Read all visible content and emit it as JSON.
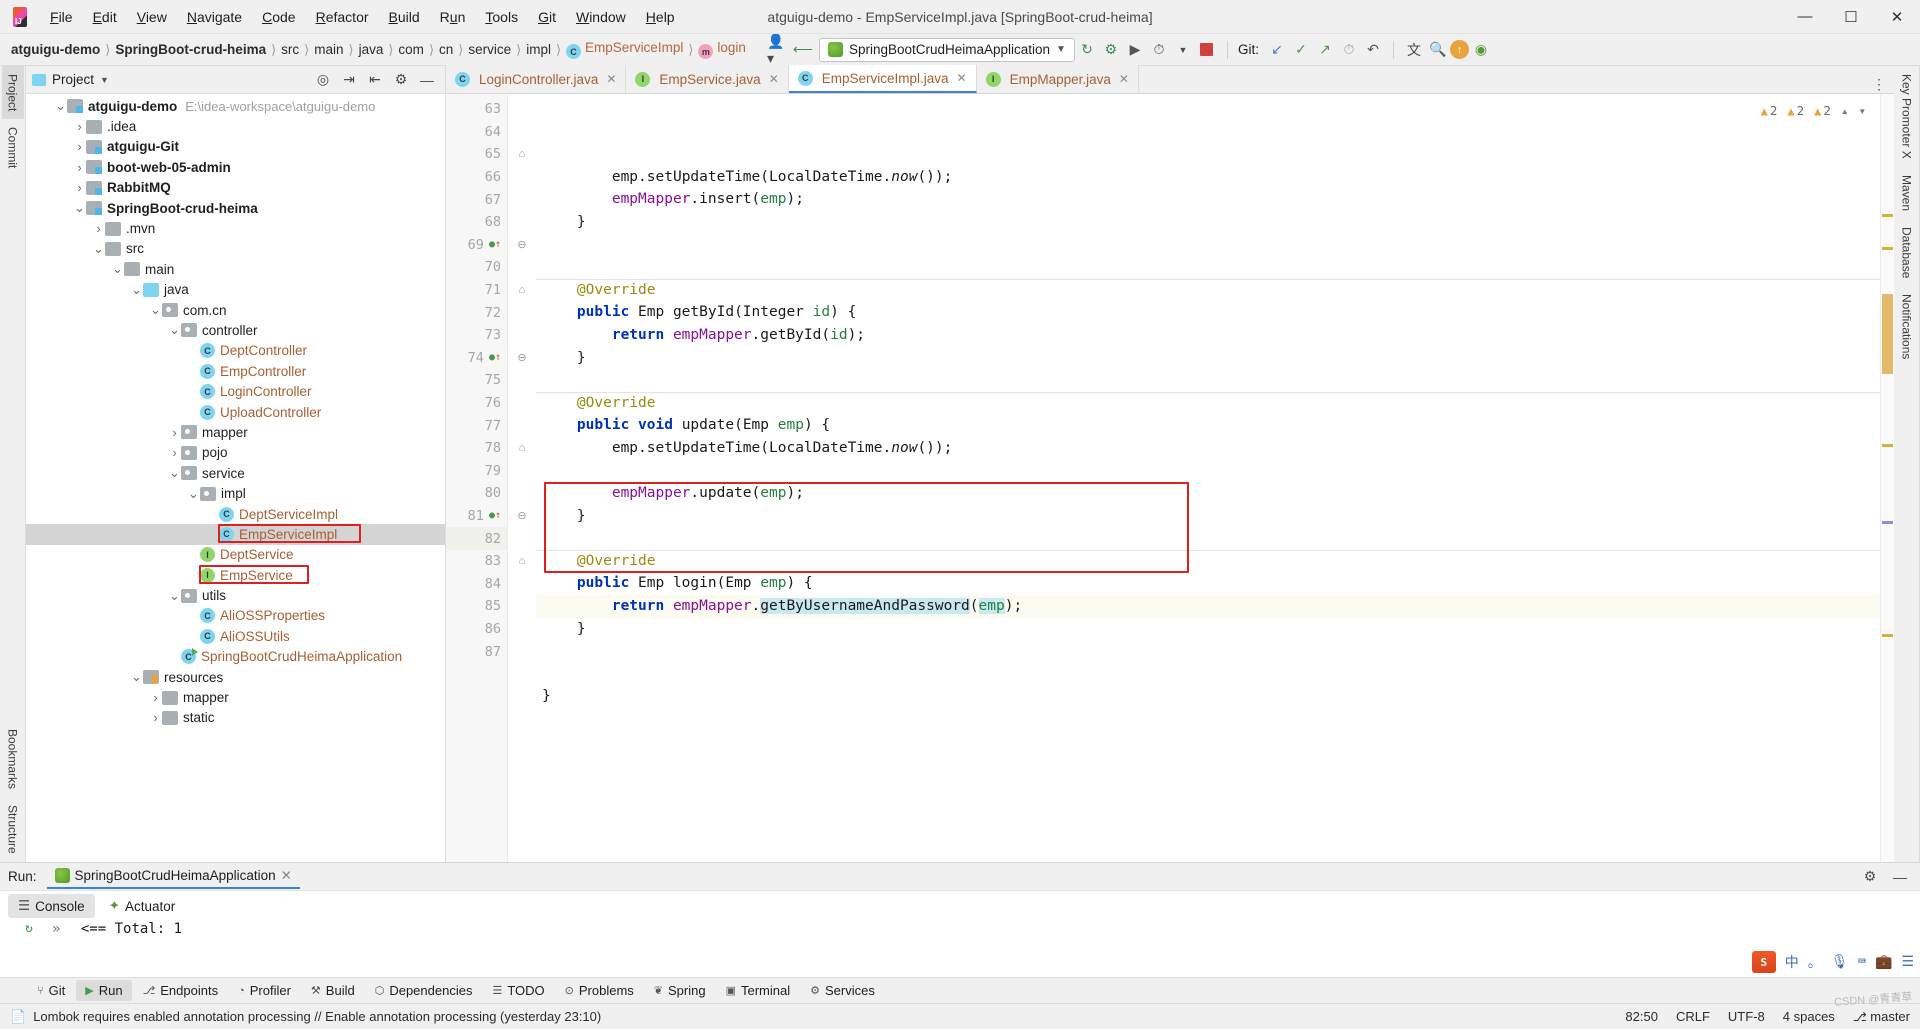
{
  "window": {
    "title": "atguigu-demo - EmpServiceImpl.java [SpringBoot-crud-heima]",
    "minimize": "—",
    "maximize": "☐",
    "close": "✕"
  },
  "menubar": [
    {
      "label": "File"
    },
    {
      "label": "Edit"
    },
    {
      "label": "View"
    },
    {
      "label": "Navigate"
    },
    {
      "label": "Code"
    },
    {
      "label": "Refactor"
    },
    {
      "label": "Build"
    },
    {
      "label": "Run"
    },
    {
      "label": "Tools"
    },
    {
      "label": "Git"
    },
    {
      "label": "Window"
    },
    {
      "label": "Help"
    }
  ],
  "navbar": {
    "crumbs": [
      {
        "label": "atguigu-demo",
        "style": "bold"
      },
      {
        "label": "SpringBoot-crud-heima",
        "style": "bold"
      },
      {
        "label": "src",
        "style": "plain"
      },
      {
        "label": "main",
        "style": "plain"
      },
      {
        "label": "java",
        "style": "plain"
      },
      {
        "label": "com",
        "style": "plain"
      },
      {
        "label": "cn",
        "style": "plain"
      },
      {
        "label": "service",
        "style": "plain"
      },
      {
        "label": "impl",
        "style": "plain"
      },
      {
        "label": "EmpServiceImpl",
        "style": "class",
        "badge": "C"
      },
      {
        "label": "login",
        "style": "method",
        "badge": "m"
      }
    ],
    "separator": "〉",
    "run_config": "SpringBootCrudHeimaApplication",
    "git_label": "Git:"
  },
  "project_panel": {
    "title": "Project",
    "tree": [
      {
        "indent": 0,
        "arrow": "v",
        "icon": "module",
        "label": "atguigu-demo",
        "bold": true,
        "path": "E:\\idea-workspace\\atguigu-demo"
      },
      {
        "indent": 1,
        "arrow": ">",
        "icon": "dir",
        "label": ".idea"
      },
      {
        "indent": 1,
        "arrow": ">",
        "icon": "module",
        "label": "atguigu-Git",
        "bold": true
      },
      {
        "indent": 1,
        "arrow": ">",
        "icon": "module",
        "label": "boot-web-05-admin",
        "bold": true
      },
      {
        "indent": 1,
        "arrow": ">",
        "icon": "module",
        "label": "RabbitMQ",
        "bold": true
      },
      {
        "indent": 1,
        "arrow": "v",
        "icon": "module",
        "label": "SpringBoot-crud-heima",
        "bold": true
      },
      {
        "indent": 2,
        "arrow": ">",
        "icon": "dir",
        "label": ".mvn"
      },
      {
        "indent": 2,
        "arrow": "v",
        "icon": "dir",
        "label": "src"
      },
      {
        "indent": 3,
        "arrow": "v",
        "icon": "dir",
        "label": "main"
      },
      {
        "indent": 4,
        "arrow": "v",
        "icon": "dir-src",
        "label": "java"
      },
      {
        "indent": 5,
        "arrow": "v",
        "icon": "pkg",
        "label": "com.cn"
      },
      {
        "indent": 6,
        "arrow": "v",
        "icon": "pkg",
        "label": "controller"
      },
      {
        "indent": 7,
        "arrow": "",
        "icon": "class-c",
        "label": "DeptController",
        "orange": true
      },
      {
        "indent": 7,
        "arrow": "",
        "icon": "class-c",
        "label": "EmpController",
        "orange": true
      },
      {
        "indent": 7,
        "arrow": "",
        "icon": "class-c",
        "label": "LoginController",
        "orange": true
      },
      {
        "indent": 7,
        "arrow": "",
        "icon": "class-c",
        "label": "UploadController",
        "orange": true
      },
      {
        "indent": 6,
        "arrow": ">",
        "icon": "pkg",
        "label": "mapper"
      },
      {
        "indent": 6,
        "arrow": ">",
        "icon": "pkg",
        "label": "pojo"
      },
      {
        "indent": 6,
        "arrow": "v",
        "icon": "pkg",
        "label": "service"
      },
      {
        "indent": 7,
        "arrow": "v",
        "icon": "pkg",
        "label": "impl"
      },
      {
        "indent": 8,
        "arrow": "",
        "icon": "class-c",
        "label": "DeptServiceImpl",
        "orange": true
      },
      {
        "indent": 8,
        "arrow": "",
        "icon": "class-c",
        "label": "EmpServiceImpl",
        "orange": true,
        "selected": true,
        "annotated": true
      },
      {
        "indent": 7,
        "arrow": "",
        "icon": "class-i",
        "label": "DeptService",
        "orange": true
      },
      {
        "indent": 7,
        "arrow": "",
        "icon": "class-i",
        "label": "EmpService",
        "orange": true,
        "annotated": true
      },
      {
        "indent": 6,
        "arrow": "v",
        "icon": "pkg",
        "label": "utils"
      },
      {
        "indent": 7,
        "arrow": "",
        "icon": "class-c",
        "label": "AliOSSProperties",
        "orange": true
      },
      {
        "indent": 7,
        "arrow": "",
        "icon": "class-c",
        "label": "AliOSSUtils",
        "orange": true
      },
      {
        "indent": 6,
        "arrow": "",
        "icon": "class-run",
        "label": "SpringBootCrudHeimaApplication",
        "orange": true
      },
      {
        "indent": 4,
        "arrow": "v",
        "icon": "res",
        "label": "resources"
      },
      {
        "indent": 5,
        "arrow": ">",
        "icon": "dir",
        "label": "mapper"
      },
      {
        "indent": 5,
        "arrow": ">",
        "icon": "dir",
        "label": "static"
      }
    ]
  },
  "editor": {
    "tabs": [
      {
        "label": "LoginController.java",
        "badge": "C",
        "active": false
      },
      {
        "label": "EmpService.java",
        "badge": "I",
        "active": false
      },
      {
        "label": "EmpServiceImpl.java",
        "badge": "C",
        "active": true
      },
      {
        "label": "EmpMapper.java",
        "badge": "I",
        "active": false
      }
    ],
    "inspections": {
      "warnings": "2",
      "weak_warnings": "2",
      "typos": "2"
    },
    "first_line": 63,
    "lines": [
      {
        "n": 63,
        "indent": 2,
        "tokens": [
          {
            "t": "emp",
            "c": "plain"
          },
          {
            "t": ".setUpdateTime(",
            "c": "plain"
          },
          {
            "t": "LocalDateTime",
            "c": "plain"
          },
          {
            "t": ".",
            "c": "plain"
          },
          {
            "t": "now",
            "c": "ital"
          },
          {
            "t": "());",
            "c": "plain"
          }
        ]
      },
      {
        "n": 64,
        "indent": 2,
        "tokens": [
          {
            "t": "empMapper",
            "c": "fld"
          },
          {
            "t": ".insert(",
            "c": "plain"
          },
          {
            "t": "emp",
            "c": "par"
          },
          {
            "t": ");",
            "c": "plain"
          }
        ]
      },
      {
        "n": 65,
        "indent": 1,
        "tokens": [
          {
            "t": "}",
            "c": "brace"
          }
        ],
        "fold": "end"
      },
      {
        "n": 66,
        "indent": 0,
        "tokens": []
      },
      {
        "n": 67,
        "indent": 0,
        "tokens": []
      },
      {
        "n": 68,
        "indent": 1,
        "tokens": [
          {
            "t": "@Override",
            "c": "anno"
          }
        ],
        "separator": true
      },
      {
        "n": 69,
        "indent": 1,
        "tokens": [
          {
            "t": "public ",
            "c": "kw"
          },
          {
            "t": "Emp ",
            "c": "plain"
          },
          {
            "t": "getById",
            "c": "plain"
          },
          {
            "t": "(",
            "c": "plain"
          },
          {
            "t": "Integer ",
            "c": "plain"
          },
          {
            "t": "id",
            "c": "par"
          },
          {
            "t": ") {",
            "c": "plain"
          }
        ],
        "gutter_icon": "override",
        "fold": "start"
      },
      {
        "n": 70,
        "indent": 2,
        "tokens": [
          {
            "t": "return ",
            "c": "kw"
          },
          {
            "t": "empMapper",
            "c": "fld"
          },
          {
            "t": ".getById(",
            "c": "plain"
          },
          {
            "t": "id",
            "c": "par"
          },
          {
            "t": ");",
            "c": "plain"
          }
        ]
      },
      {
        "n": 71,
        "indent": 1,
        "tokens": [
          {
            "t": "}",
            "c": "brace"
          }
        ],
        "fold": "end"
      },
      {
        "n": 72,
        "indent": 0,
        "tokens": []
      },
      {
        "n": 73,
        "indent": 1,
        "tokens": [
          {
            "t": "@Override",
            "c": "anno"
          }
        ],
        "separator": true
      },
      {
        "n": 74,
        "indent": 1,
        "tokens": [
          {
            "t": "public ",
            "c": "kw"
          },
          {
            "t": "void ",
            "c": "kw"
          },
          {
            "t": "update",
            "c": "plain"
          },
          {
            "t": "(",
            "c": "plain"
          },
          {
            "t": "Emp ",
            "c": "plain"
          },
          {
            "t": "emp",
            "c": "par"
          },
          {
            "t": ") {",
            "c": "plain"
          }
        ],
        "gutter_icon": "override-anno",
        "fold": "start"
      },
      {
        "n": 75,
        "indent": 2,
        "tokens": [
          {
            "t": "emp",
            "c": "plain"
          },
          {
            "t": ".setUpdateTime(",
            "c": "plain"
          },
          {
            "t": "LocalDateTime",
            "c": "plain"
          },
          {
            "t": ".",
            "c": "plain"
          },
          {
            "t": "now",
            "c": "ital"
          },
          {
            "t": "());",
            "c": "plain"
          }
        ]
      },
      {
        "n": 76,
        "indent": 0,
        "tokens": []
      },
      {
        "n": 77,
        "indent": 2,
        "tokens": [
          {
            "t": "empMapper",
            "c": "fld"
          },
          {
            "t": ".update(",
            "c": "plain"
          },
          {
            "t": "emp",
            "c": "par"
          },
          {
            "t": ");",
            "c": "plain"
          }
        ]
      },
      {
        "n": 78,
        "indent": 1,
        "tokens": [
          {
            "t": "}",
            "c": "brace"
          }
        ],
        "fold": "end"
      },
      {
        "n": 79,
        "indent": 0,
        "tokens": []
      },
      {
        "n": 80,
        "indent": 1,
        "tokens": [
          {
            "t": "@Override",
            "c": "anno"
          }
        ],
        "separator": true
      },
      {
        "n": 81,
        "indent": 1,
        "tokens": [
          {
            "t": "public ",
            "c": "kw"
          },
          {
            "t": "Emp ",
            "c": "plain"
          },
          {
            "t": "login",
            "c": "plain"
          },
          {
            "t": "(",
            "c": "plain"
          },
          {
            "t": "Emp ",
            "c": "plain"
          },
          {
            "t": "emp",
            "c": "par"
          },
          {
            "t": ") {",
            "c": "plain"
          }
        ],
        "gutter_icon": "override",
        "fold": "start"
      },
      {
        "n": 82,
        "indent": 2,
        "tokens": [
          {
            "t": "return ",
            "c": "kw"
          },
          {
            "t": "empMapper",
            "c": "fld"
          },
          {
            "t": ".",
            "c": "plain"
          },
          {
            "t": "getByUsernameAndPassword",
            "c": "sel"
          },
          {
            "t": "(",
            "c": "plain"
          },
          {
            "t": "emp",
            "c": "par-sel"
          },
          {
            "t": ");",
            "c": "plain"
          }
        ],
        "current": true,
        "breakpoint": true
      },
      {
        "n": 83,
        "indent": 1,
        "tokens": [
          {
            "t": "}",
            "c": "brace"
          }
        ],
        "fold": "end"
      },
      {
        "n": 84,
        "indent": 0,
        "tokens": []
      },
      {
        "n": 85,
        "indent": 0,
        "tokens": []
      },
      {
        "n": 86,
        "indent": 0,
        "tokens": [
          {
            "t": "}",
            "c": "brace"
          }
        ]
      },
      {
        "n": 87,
        "indent": 0,
        "tokens": []
      }
    ]
  },
  "run_panel": {
    "label": "Run:",
    "config_tab": "SpringBootCrudHeimaApplication",
    "sub_tabs": [
      {
        "label": "Console",
        "active": true
      },
      {
        "label": "Actuator",
        "active": false
      }
    ],
    "console_text": "<== Total: 1",
    "prompt": "»"
  },
  "bottom_bar": [
    {
      "label": "Git",
      "icon": "branch-icon",
      "active": false
    },
    {
      "label": "Run",
      "icon": "run-icon",
      "active": true
    },
    {
      "label": "Endpoints",
      "icon": "endpoints-icon",
      "active": false
    },
    {
      "label": "Profiler",
      "icon": "profiler-icon",
      "active": false
    },
    {
      "label": "Build",
      "icon": "build-icon",
      "active": false
    },
    {
      "label": "Dependencies",
      "icon": "dependencies-icon",
      "active": false
    },
    {
      "label": "TODO",
      "icon": "todo-icon",
      "active": false
    },
    {
      "label": "Problems",
      "icon": "problems-icon",
      "active": false
    },
    {
      "label": "Spring",
      "icon": "spring-icon",
      "active": false
    },
    {
      "label": "Terminal",
      "icon": "terminal-icon",
      "active": false
    },
    {
      "label": "Services",
      "icon": "services-icon",
      "active": false
    }
  ],
  "status_bar": {
    "message": "Lombok requires enabled annotation processing // Enable annotation processing (yesterday 23:10)",
    "caret": "82:50",
    "line_sep": "CRLF",
    "encoding": "UTF-8",
    "indent": "4 spaces",
    "branch": "master"
  },
  "left_rail": [
    {
      "label": "Project",
      "active": true
    },
    {
      "label": "Commit",
      "active": false
    },
    {
      "label": "Bookmarks",
      "active": false
    },
    {
      "label": "Structure",
      "active": false
    }
  ],
  "right_rail": [
    {
      "label": "Key Promoter X"
    },
    {
      "label": "Maven"
    },
    {
      "label": "Database"
    },
    {
      "label": "Notifications"
    }
  ],
  "colors": {
    "accent": "#3c82d6",
    "annotation_red": "#e02020",
    "keyword": "#0033b3",
    "field": "#871094",
    "annotation": "#9e880d",
    "parameter": "#267f3f",
    "selection": "#c9e9f0",
    "orange_file": "#a85f33"
  }
}
